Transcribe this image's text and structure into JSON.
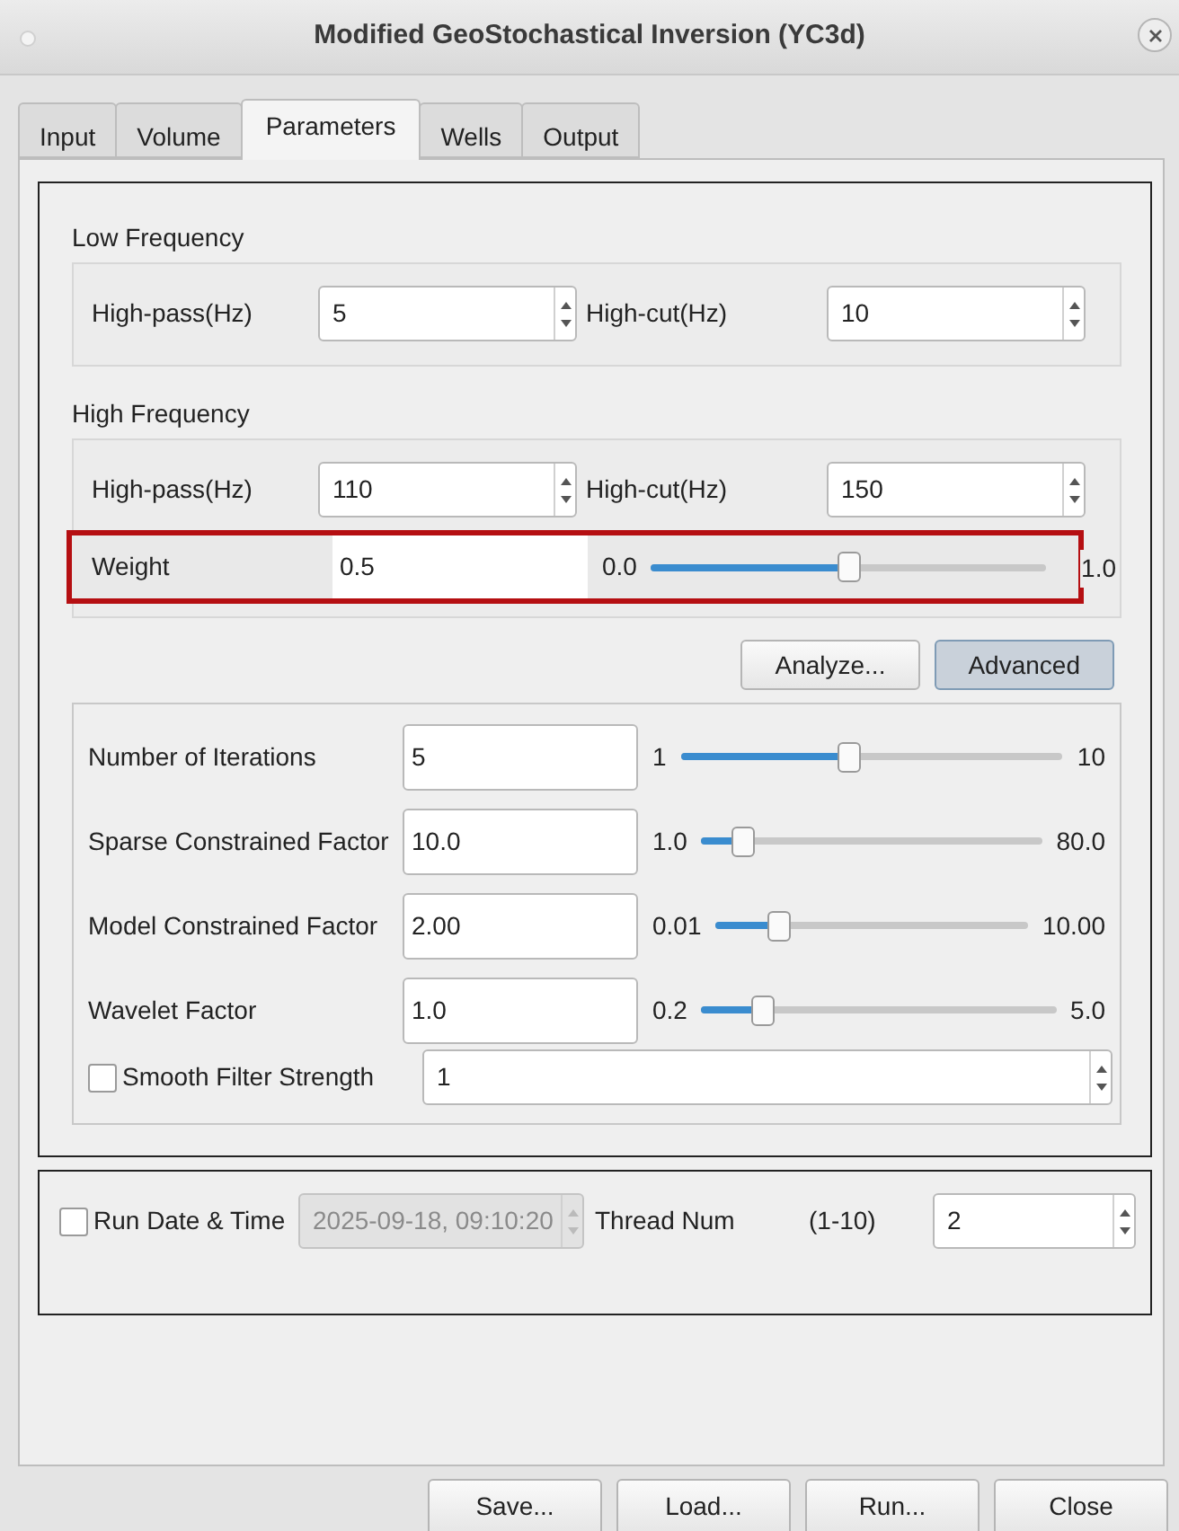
{
  "window": {
    "title": "Modified GeoStochastical Inversion (YC3d)"
  },
  "tabs": [
    {
      "label": "Input",
      "selected": false
    },
    {
      "label": "Volume",
      "selected": false
    },
    {
      "label": "Parameters",
      "selected": true
    },
    {
      "label": "Wells",
      "selected": false
    },
    {
      "label": "Output",
      "selected": false
    }
  ],
  "low_frequency": {
    "title": "Low Frequency",
    "fields": [
      {
        "label": "High-pass(Hz)",
        "value": "5"
      },
      {
        "label": "High-cut(Hz)",
        "value": "10"
      }
    ]
  },
  "high_frequency": {
    "title": "High Frequency",
    "fields": [
      {
        "label": "High-pass(Hz)",
        "value": "110"
      },
      {
        "label": "High-cut(Hz)",
        "value": "150"
      }
    ],
    "weight": {
      "label": "Weight",
      "value": "0.5",
      "min": "0.0",
      "max": "1.0",
      "level": 0.5,
      "highlighted": true
    }
  },
  "action_buttons": [
    {
      "label": "Analyze...",
      "selected": false
    },
    {
      "label": "Advanced",
      "selected": true
    }
  ],
  "advanced": {
    "sliders": [
      {
        "label": "Number of Iterations",
        "value": "5",
        "min": "1",
        "max": "10",
        "level": 0.44
      },
      {
        "label": "Sparse Constrained Factor",
        "value": "10.0",
        "min": "1.0",
        "max": "80.0",
        "level": 0.12
      },
      {
        "label": "Model Constrained Factor",
        "value": "2.00",
        "min": "0.01",
        "max": "10.00",
        "level": 0.2
      },
      {
        "label": "Wavelet Factor",
        "value": "1.0",
        "min": "0.2",
        "max": "5.0",
        "level": 0.17
      }
    ],
    "smooth_filter": {
      "label": "Smooth Filter Strength",
      "checked": false,
      "value": "1"
    }
  },
  "run_options": {
    "run_date": {
      "label": "Run Date & Time",
      "checked": false,
      "value": "2025-09-18, 09:10:20",
      "disabled": true
    },
    "thread": {
      "label": "Thread Num",
      "range": "(1-10)",
      "value": "2"
    }
  },
  "footer_buttons": [
    "Save...",
    "Load...",
    "Run...",
    "Close"
  ]
}
